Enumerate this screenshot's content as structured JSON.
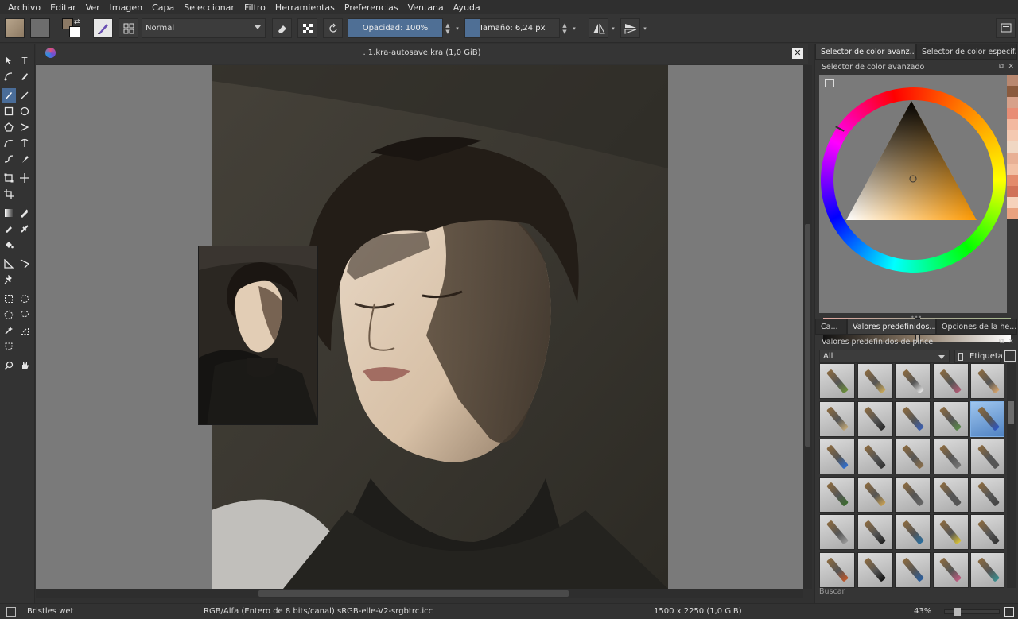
{
  "menu": [
    "Archivo",
    "Editar",
    "Ver",
    "Imagen",
    "Capa",
    "Seleccionar",
    "Filtro",
    "Herramientas",
    "Preferencias",
    "Ventana",
    "Ayuda"
  ],
  "toolbar": {
    "blend_mode": "Normal",
    "opacity_label": "Opacidad:  100%",
    "opacity_fraction": 1.0,
    "size_label": "Tamaño:  6,24 px",
    "size_fraction": 0.03
  },
  "document": {
    "title": ". 1.kra-autosave.kra (1,0 GiB)"
  },
  "docker": {
    "color_tab_1": "Selector de color avanz...",
    "color_tab_2": "Selector de color especif...",
    "color_panel_title": "Selector de color avanzado",
    "preset_tab_1": "Ca...",
    "preset_tab_2": "Valores predefinidos...",
    "preset_tab_3": "Opciones de la he...",
    "preset_panel_title": "Valores predefinidos de pincel",
    "filter_value": "All",
    "tag_label": "Etiqueta",
    "search_placeholder": "Buscar"
  },
  "palette_colors": [
    "#b98870",
    "#8a5a3d",
    "#d7a18a",
    "#e88d75",
    "#f3b9a0",
    "#f4c9b1",
    "#f0d7c3",
    "#e8b095",
    "#f2c0a4",
    "#e38b6c",
    "#d07258",
    "#f6d2bb",
    "#e9a27f"
  ],
  "status": {
    "brush": "Bristles wet",
    "color_model": "RGB/Alfa (Entero de 8 bits/canal)  sRGB-elle-V2-srgbtrc.icc",
    "dimensions": "1500 x 2250 (1,0 GiB)",
    "zoom": "43%"
  }
}
